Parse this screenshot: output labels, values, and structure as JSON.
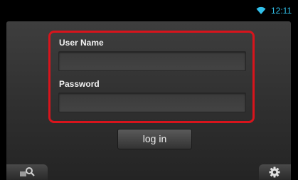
{
  "status_bar": {
    "time": "12:11",
    "wifi_icon": "wifi-icon"
  },
  "login_form": {
    "username_label": "User Name",
    "username_value": "",
    "password_label": "Password",
    "password_value": "",
    "login_button_label": "log in",
    "highlight_color": "#d8141c"
  },
  "bottom_bar": {
    "left_icon": "search-source-icon",
    "right_icon": "gear-icon"
  }
}
